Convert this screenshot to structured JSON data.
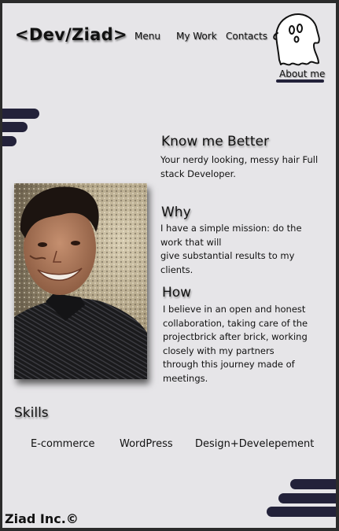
{
  "header": {
    "logo": "<Dev/Ziad>",
    "nav": [
      {
        "label": "Menu"
      },
      {
        "label": "My Work"
      },
      {
        "label": "Contacts"
      }
    ],
    "about_label": "About me"
  },
  "about": {
    "know_title": "Know me Better",
    "know_lines": [
      "Your nerdy looking, messy hair Full",
      "stack Developer."
    ],
    "why_title": "Why",
    "why_lines": [
      "I have a simple mission: do the",
      "work that will",
      "give substantial results to my",
      "clients."
    ],
    "how_title": "How",
    "how_lines": [
      "I believe in an open and honest",
      "collaboration, taking care of the",
      "projectbrick after brick, working",
      "closely with my partners",
      "through this journey made of",
      "meetings."
    ]
  },
  "skills": {
    "title": "Skills",
    "items": [
      "E-commerce",
      "WordPress",
      "Design+Develepement"
    ]
  },
  "footer": {
    "copyright": "Ziad Inc.©"
  },
  "theme": {
    "page_bg": "#e6e5e8",
    "accent": "#23223a",
    "frame": "#2b2b2b"
  },
  "icons": {
    "ghost": "ghost-icon"
  }
}
